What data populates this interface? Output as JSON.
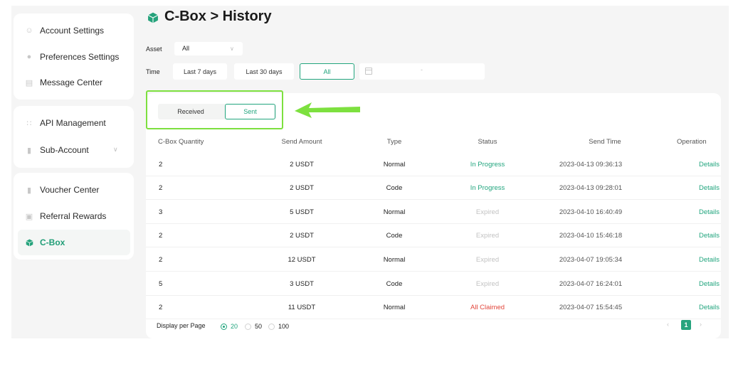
{
  "sidebar": {
    "groups": [
      {
        "items": [
          {
            "label": "Account Settings",
            "icon": "user-icon"
          },
          {
            "label": "Preferences Settings",
            "icon": "palette-icon"
          },
          {
            "label": "Message Center",
            "icon": "message-icon"
          }
        ]
      },
      {
        "items": [
          {
            "label": "API Management",
            "icon": "api-icon"
          },
          {
            "label": "Sub-Account",
            "icon": "sub-account-icon"
          }
        ]
      },
      {
        "items": [
          {
            "label": "Voucher Center",
            "icon": "voucher-icon"
          },
          {
            "label": "Referral Rewards",
            "icon": "referral-icon"
          },
          {
            "label": "C-Box",
            "icon": "cube-icon",
            "active": true
          }
        ]
      }
    ]
  },
  "header": {
    "title": "C-Box > History"
  },
  "filters": {
    "asset_label": "Asset",
    "asset_value": "All",
    "time_label": "Time",
    "time_options": [
      "Last 7 days",
      "Last 30 days",
      "All"
    ],
    "time_selected": "All",
    "date_separator": "-"
  },
  "tabs": {
    "items": [
      "Received",
      "Sent"
    ],
    "selected": "Sent"
  },
  "table": {
    "columns": [
      "C-Box Quantity",
      "Send Amount",
      "Type",
      "Status",
      "Send Time",
      "Operation"
    ],
    "rows": [
      {
        "qty": "2",
        "amount": "2 USDT",
        "type": "Normal",
        "status": "In Progress",
        "status_kind": "progress",
        "time": "2023-04-13 09:36:13",
        "op": "Details"
      },
      {
        "qty": "2",
        "amount": "2 USDT",
        "type": "Code",
        "status": "In Progress",
        "status_kind": "progress",
        "time": "2023-04-13 09:28:01",
        "op": "Details"
      },
      {
        "qty": "3",
        "amount": "5 USDT",
        "type": "Normal",
        "status": "Expired",
        "status_kind": "expired",
        "time": "2023-04-10 16:40:49",
        "op": "Details"
      },
      {
        "qty": "2",
        "amount": "2 USDT",
        "type": "Code",
        "status": "Expired",
        "status_kind": "expired",
        "time": "2023-04-10 15:46:18",
        "op": "Details"
      },
      {
        "qty": "2",
        "amount": "12 USDT",
        "type": "Normal",
        "status": "Expired",
        "status_kind": "expired",
        "time": "2023-04-07 19:05:34",
        "op": "Details"
      },
      {
        "qty": "5",
        "amount": "3 USDT",
        "type": "Code",
        "status": "Expired",
        "status_kind": "expired",
        "time": "2023-04-07 16:24:01",
        "op": "Details"
      },
      {
        "qty": "2",
        "amount": "11 USDT",
        "type": "Normal",
        "status": "All Claimed",
        "status_kind": "claimed",
        "time": "2023-04-07 15:54:45",
        "op": "Details"
      }
    ]
  },
  "footer": {
    "per_page_label": "Display per Page",
    "per_page_options": [
      "20",
      "50",
      "100"
    ],
    "per_page_selected": "20",
    "current_page": "1"
  },
  "colors": {
    "accent": "#22a57e",
    "highlight": "#7de03f",
    "danger": "#e2463b",
    "muted": "#c2c2c2"
  }
}
